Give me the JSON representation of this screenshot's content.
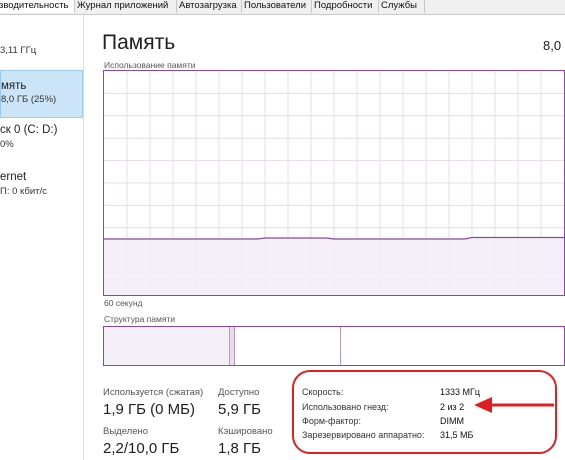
{
  "tabs": [
    {
      "label": "зводительность",
      "active": true
    },
    {
      "label": "Журнал приложений",
      "active": false
    },
    {
      "label": "Автозагрузка",
      "active": false
    },
    {
      "label": "Пользователи",
      "active": false
    },
    {
      "label": "Подробности",
      "active": false
    },
    {
      "label": "Службы",
      "active": false
    }
  ],
  "sidebar": {
    "cpu": {
      "sub": "3,11 ГГц"
    },
    "memory": {
      "title": "мять",
      "sub": "8,0 ГБ (25%)"
    },
    "disk": {
      "title": "ск 0 (C: D:)",
      "sub": "0%"
    },
    "ethernet": {
      "title": "ernet",
      "sub": "П: 0 кбит/с"
    }
  },
  "main": {
    "title": "Память",
    "total": "8,0",
    "usage_label": "Использование памяти",
    "time_label": "60 секунд",
    "structure_label": "Структура памяти"
  },
  "graph": {
    "usage_fraction": 0.25,
    "line_color": "#8b47a8",
    "fill_color": "#f4eef7"
  },
  "stats": {
    "in_use_label": "Используется (сжатая)",
    "in_use_value": "1,9 ГБ (0 МБ)",
    "available_label": "Доступно",
    "available_value": "5,9 ГБ",
    "committed_label": "Выделено",
    "committed_value": "2,2/10,0 ГБ",
    "cached_label": "Кэшировано",
    "cached_value": "1,8 ГБ"
  },
  "properties": [
    {
      "label": "Скорость:",
      "value": "1333 МГц"
    },
    {
      "label": "Использовано гнезд:",
      "value": "2 из 2"
    },
    {
      "label": "Форм-фактор:",
      "value": "DIMM"
    },
    {
      "label": "Зарезервировано аппаратно:",
      "value": "31,5 МБ"
    }
  ],
  "colors": {
    "accent": "#8b47a8",
    "highlight_border": "#e02020",
    "selected_bg": "#cce4f7"
  }
}
